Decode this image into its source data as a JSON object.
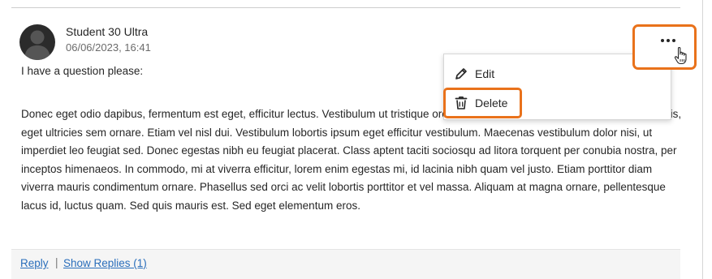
{
  "post": {
    "author": "Student 30 Ultra",
    "timestamp": "06/06/2023, 16:41",
    "question": "I have a question please:",
    "body": "Donec eget odio dapibus, fermentum est eget, efficitur lectus. Vestibulum ut tristique orci. Aenean vel elit nec mi tincidunt iaculis lobortis, eget ultricies sem ornare. Etiam vel nisl dui. Vestibulum lobortis ipsum eget efficitur vestibulum. Maecenas vestibulum dolor nisi, ut imperdiet leo feugiat sed. Donec egestas nibh eu feugiat placerat. Class aptent taciti sociosqu ad litora torquent per conubia nostra, per inceptos himenaeos. In commodo, mi at viverra efficitur, lorem enim egestas mi, id lacinia nibh quam vel justo. Etiam porttitor diam viverra mauris condimentum ornare. Phasellus sed orci ac velit lobortis porttitor et vel massa. Aliquam at magna ornare, pellentesque lacus id, luctus quam. Sed quis mauris est. Sed eget elementum eros."
  },
  "menu": {
    "items": [
      {
        "label": "Edit",
        "icon": "pencil-icon"
      },
      {
        "label": "Delete",
        "icon": "trash-icon"
      }
    ]
  },
  "footer": {
    "reply": "Reply",
    "separator": "|",
    "show_replies": "Show Replies (1)"
  },
  "colors": {
    "highlight": "#e9721b",
    "link": "#2a6ebb",
    "text": "#262626",
    "footer_bg": "#f5f5f5"
  }
}
